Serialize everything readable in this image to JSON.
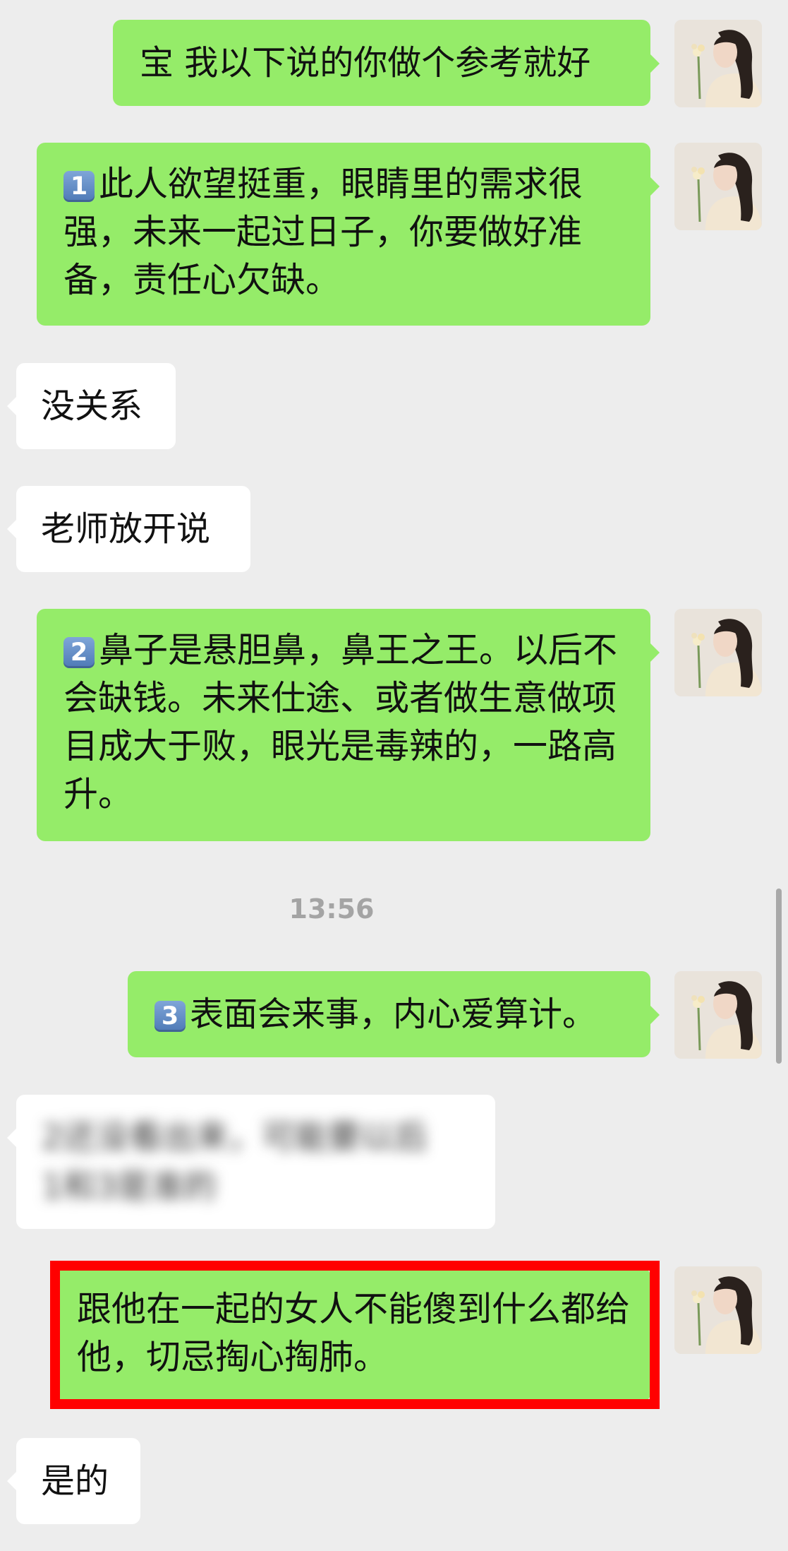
{
  "timestamp": "13:56",
  "messages": [
    {
      "side": "out",
      "text": "宝 我以下说的你做个参考就好"
    },
    {
      "side": "out",
      "badge": "1",
      "text": "此人欲望挺重，眼睛里的需求很强，未来一起过日子，你要做好准备，责任心欠缺。"
    },
    {
      "side": "in",
      "text": "没关系"
    },
    {
      "side": "in",
      "text": "老师放开说"
    },
    {
      "side": "out",
      "badge": "2",
      "text": "鼻子是悬胆鼻，鼻王之王。以后不会缺钱。未来仕途、或者做生意做项目成大于败，眼光是毒辣的，一路高升。"
    },
    {
      "side": "out",
      "badge": "3",
      "text": "表面会来事，内心爱算计。"
    },
    {
      "side": "in",
      "blurred": true,
      "lines": [
        "2还没看出来，可能要以后",
        "1和3是准的"
      ]
    },
    {
      "side": "out",
      "highlighted": true,
      "text": "跟他在一起的女人不能傻到什么都给他，切忌掏心掏肺。"
    },
    {
      "side": "in",
      "text": "是的"
    }
  ]
}
